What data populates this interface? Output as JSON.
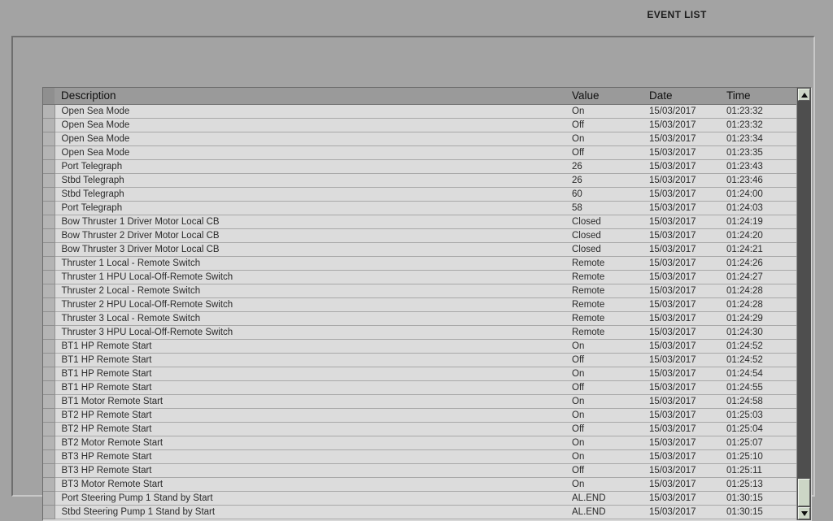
{
  "screen": {
    "title": "EVENT LIST"
  },
  "table": {
    "columns": {
      "description": "Description",
      "value": "Value",
      "date": "Date",
      "time": "Time"
    },
    "rows": [
      {
        "description": "Open Sea Mode",
        "value": "On",
        "date": "15/03/2017",
        "time": "01:23:32"
      },
      {
        "description": "Open Sea Mode",
        "value": "Off",
        "date": "15/03/2017",
        "time": "01:23:32"
      },
      {
        "description": "Open Sea Mode",
        "value": "On",
        "date": "15/03/2017",
        "time": "01:23:34"
      },
      {
        "description": "Open Sea Mode",
        "value": "Off",
        "date": "15/03/2017",
        "time": "01:23:35"
      },
      {
        "description": "Port Telegraph",
        "value": "26",
        "date": "15/03/2017",
        "time": "01:23:43"
      },
      {
        "description": "Stbd Telegraph",
        "value": "26",
        "date": "15/03/2017",
        "time": "01:23:46"
      },
      {
        "description": "Stbd Telegraph",
        "value": "60",
        "date": "15/03/2017",
        "time": "01:24:00"
      },
      {
        "description": "Port Telegraph",
        "value": "58",
        "date": "15/03/2017",
        "time": "01:24:03"
      },
      {
        "description": "Bow Thruster 1 Driver Motor Local CB",
        "value": "Closed",
        "date": "15/03/2017",
        "time": "01:24:19"
      },
      {
        "description": "Bow Thruster 2 Driver Motor Local CB",
        "value": "Closed",
        "date": "15/03/2017",
        "time": "01:24:20"
      },
      {
        "description": "Bow Thruster 3 Driver Motor Local CB",
        "value": "Closed",
        "date": "15/03/2017",
        "time": "01:24:21"
      },
      {
        "description": "Thruster 1 Local - Remote Switch",
        "value": "Remote",
        "date": "15/03/2017",
        "time": "01:24:26"
      },
      {
        "description": "Thruster 1 HPU Local-Off-Remote Switch",
        "value": "Remote",
        "date": "15/03/2017",
        "time": "01:24:27"
      },
      {
        "description": "Thruster 2 Local - Remote Switch",
        "value": "Remote",
        "date": "15/03/2017",
        "time": "01:24:28"
      },
      {
        "description": "Thruster 2 HPU Local-Off-Remote Switch",
        "value": "Remote",
        "date": "15/03/2017",
        "time": "01:24:28"
      },
      {
        "description": "Thruster 3 Local - Remote Switch",
        "value": "Remote",
        "date": "15/03/2017",
        "time": "01:24:29"
      },
      {
        "description": "Thruster 3 HPU Local-Off-Remote Switch",
        "value": "Remote",
        "date": "15/03/2017",
        "time": "01:24:30"
      },
      {
        "description": "BT1 HP Remote Start",
        "value": "On",
        "date": "15/03/2017",
        "time": "01:24:52"
      },
      {
        "description": "BT1 HP Remote Start",
        "value": "Off",
        "date": "15/03/2017",
        "time": "01:24:52"
      },
      {
        "description": "BT1 HP Remote Start",
        "value": "On",
        "date": "15/03/2017",
        "time": "01:24:54"
      },
      {
        "description": "BT1 HP Remote Start",
        "value": "Off",
        "date": "15/03/2017",
        "time": "01:24:55"
      },
      {
        "description": "BT1 Motor Remote Start",
        "value": "On",
        "date": "15/03/2017",
        "time": "01:24:58"
      },
      {
        "description": "BT2 HP Remote Start",
        "value": "On",
        "date": "15/03/2017",
        "time": "01:25:03"
      },
      {
        "description": "BT2 HP Remote Start",
        "value": "Off",
        "date": "15/03/2017",
        "time": "01:25:04"
      },
      {
        "description": "BT2 Motor Remote Start",
        "value": "On",
        "date": "15/03/2017",
        "time": "01:25:07"
      },
      {
        "description": "BT3 HP Remote Start",
        "value": "On",
        "date": "15/03/2017",
        "time": "01:25:10"
      },
      {
        "description": "BT3 HP Remote Start",
        "value": "Off",
        "date": "15/03/2017",
        "time": "01:25:11"
      },
      {
        "description": "BT3 Motor Remote Start",
        "value": "On",
        "date": "15/03/2017",
        "time": "01:25:13"
      },
      {
        "description": "Port Steering Pump 1 Stand by Start",
        "value": "AL.END",
        "date": "15/03/2017",
        "time": "01:30:15"
      },
      {
        "description": "Stbd Steering Pump 1 Stand by Start",
        "value": "AL.END",
        "date": "15/03/2017",
        "time": "01:30:15"
      }
    ]
  },
  "scrollbar": {
    "up_icon": "triangle-up-icon",
    "down_icon": "triangle-down-icon"
  },
  "colors": {
    "background": "#a3a3a3",
    "header": "#9a9a9a",
    "row": "#dcdcdc",
    "scroll_track": "#4e4e4e",
    "scroll_thumb": "#ccd6c6"
  }
}
